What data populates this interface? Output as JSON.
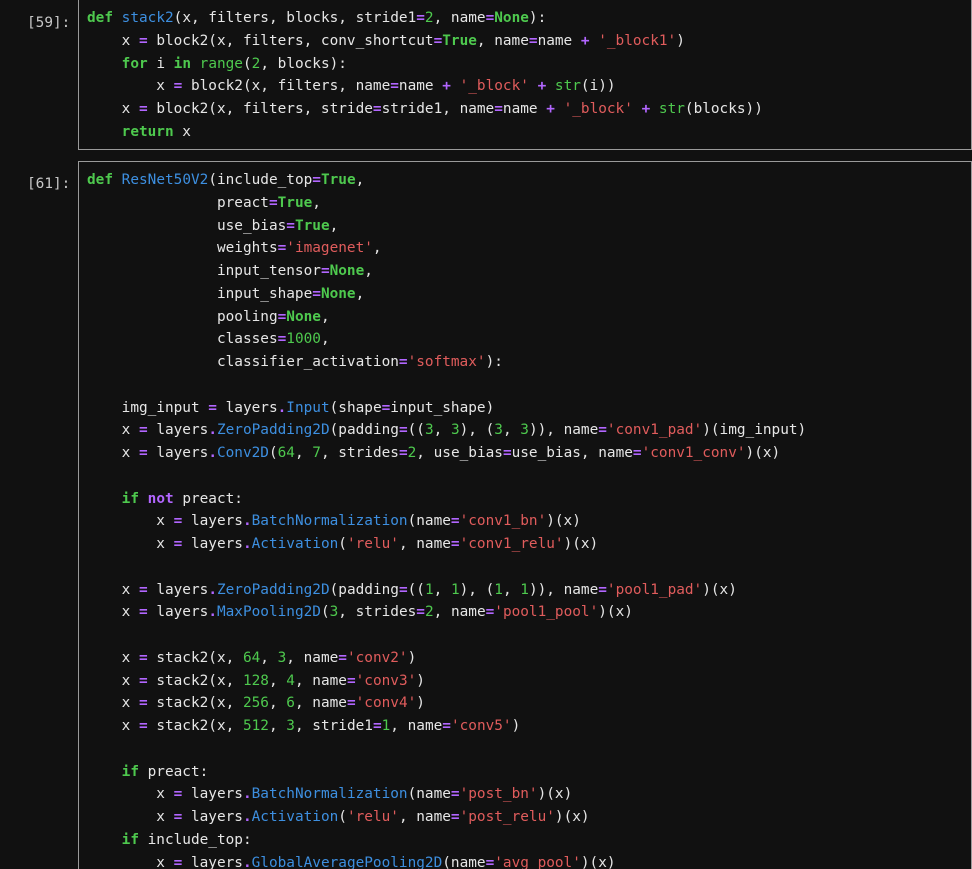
{
  "cells": [
    {
      "prompt": "[59]:",
      "lines": [
        [
          [
            "kw",
            "def"
          ],
          [
            "t",
            " "
          ],
          [
            "fn",
            "stack2"
          ],
          [
            "t",
            "(x, filters, blocks, stride1"
          ],
          [
            "op",
            "="
          ],
          [
            "num",
            "2"
          ],
          [
            "t",
            ", name"
          ],
          [
            "op",
            "="
          ],
          [
            "kw",
            "None"
          ],
          [
            "t",
            "):"
          ]
        ],
        [
          [
            "t",
            "    x "
          ],
          [
            "op",
            "="
          ],
          [
            "t",
            " block2(x, filters, conv_shortcut"
          ],
          [
            "op",
            "="
          ],
          [
            "kw",
            "True"
          ],
          [
            "t",
            ", name"
          ],
          [
            "op",
            "="
          ],
          [
            "t",
            "name "
          ],
          [
            "op",
            "+"
          ],
          [
            "t",
            " "
          ],
          [
            "str",
            "'_block1'"
          ],
          [
            "t",
            ")"
          ]
        ],
        [
          [
            "t",
            "    "
          ],
          [
            "kw",
            "for"
          ],
          [
            "t",
            " i "
          ],
          [
            "kw",
            "in"
          ],
          [
            "t",
            " "
          ],
          [
            "bi",
            "range"
          ],
          [
            "t",
            "("
          ],
          [
            "num",
            "2"
          ],
          [
            "t",
            ", blocks):"
          ]
        ],
        [
          [
            "t",
            "        x "
          ],
          [
            "op",
            "="
          ],
          [
            "t",
            " block2(x, filters, name"
          ],
          [
            "op",
            "="
          ],
          [
            "t",
            "name "
          ],
          [
            "op",
            "+"
          ],
          [
            "t",
            " "
          ],
          [
            "str",
            "'_block'"
          ],
          [
            "t",
            " "
          ],
          [
            "op",
            "+"
          ],
          [
            "t",
            " "
          ],
          [
            "bi",
            "str"
          ],
          [
            "t",
            "(i))"
          ]
        ],
        [
          [
            "t",
            "    x "
          ],
          [
            "op",
            "="
          ],
          [
            "t",
            " block2(x, filters, stride"
          ],
          [
            "op",
            "="
          ],
          [
            "t",
            "stride1, name"
          ],
          [
            "op",
            "="
          ],
          [
            "t",
            "name "
          ],
          [
            "op",
            "+"
          ],
          [
            "t",
            " "
          ],
          [
            "str",
            "'_block'"
          ],
          [
            "t",
            " "
          ],
          [
            "op",
            "+"
          ],
          [
            "t",
            " "
          ],
          [
            "bi",
            "str"
          ],
          [
            "t",
            "(blocks))"
          ]
        ],
        [
          [
            "t",
            "    "
          ],
          [
            "kw",
            "return"
          ],
          [
            "t",
            " x"
          ]
        ]
      ]
    },
    {
      "prompt": "[61]:",
      "lines": [
        [
          [
            "kw",
            "def"
          ],
          [
            "t",
            " "
          ],
          [
            "fn",
            "ResNet50V2"
          ],
          [
            "t",
            "(include_top"
          ],
          [
            "op",
            "="
          ],
          [
            "kw",
            "True"
          ],
          [
            "t",
            ","
          ]
        ],
        [
          [
            "t",
            "               preact"
          ],
          [
            "op",
            "="
          ],
          [
            "kw",
            "True"
          ],
          [
            "t",
            ","
          ]
        ],
        [
          [
            "t",
            "               use_bias"
          ],
          [
            "op",
            "="
          ],
          [
            "kw",
            "True"
          ],
          [
            "t",
            ","
          ]
        ],
        [
          [
            "t",
            "               weights"
          ],
          [
            "op",
            "="
          ],
          [
            "str",
            "'imagenet'"
          ],
          [
            "t",
            ","
          ]
        ],
        [
          [
            "t",
            "               input_tensor"
          ],
          [
            "op",
            "="
          ],
          [
            "kw",
            "None"
          ],
          [
            "t",
            ","
          ]
        ],
        [
          [
            "t",
            "               input_shape"
          ],
          [
            "op",
            "="
          ],
          [
            "kw",
            "None"
          ],
          [
            "t",
            ","
          ]
        ],
        [
          [
            "t",
            "               pooling"
          ],
          [
            "op",
            "="
          ],
          [
            "kw",
            "None"
          ],
          [
            "t",
            ","
          ]
        ],
        [
          [
            "t",
            "               classes"
          ],
          [
            "op",
            "="
          ],
          [
            "num",
            "1000"
          ],
          [
            "t",
            ","
          ]
        ],
        [
          [
            "t",
            "               classifier_activation"
          ],
          [
            "op",
            "="
          ],
          [
            "str",
            "'softmax'"
          ],
          [
            "t",
            "):"
          ]
        ],
        [
          [
            "t",
            ""
          ]
        ],
        [
          [
            "t",
            "    img_input "
          ],
          [
            "op",
            "="
          ],
          [
            "t",
            " layers"
          ],
          [
            "op",
            "."
          ],
          [
            "cls",
            "Input"
          ],
          [
            "t",
            "(shape"
          ],
          [
            "op",
            "="
          ],
          [
            "t",
            "input_shape)"
          ]
        ],
        [
          [
            "t",
            "    x "
          ],
          [
            "op",
            "="
          ],
          [
            "t",
            " layers"
          ],
          [
            "op",
            "."
          ],
          [
            "cls",
            "ZeroPadding2D"
          ],
          [
            "t",
            "(padding"
          ],
          [
            "op",
            "="
          ],
          [
            "t",
            "(("
          ],
          [
            "num",
            "3"
          ],
          [
            "t",
            ", "
          ],
          [
            "num",
            "3"
          ],
          [
            "t",
            "), ("
          ],
          [
            "num",
            "3"
          ],
          [
            "t",
            ", "
          ],
          [
            "num",
            "3"
          ],
          [
            "t",
            ")), name"
          ],
          [
            "op",
            "="
          ],
          [
            "str",
            "'conv1_pad'"
          ],
          [
            "t",
            ")(img_input)"
          ]
        ],
        [
          [
            "t",
            "    x "
          ],
          [
            "op",
            "="
          ],
          [
            "t",
            " layers"
          ],
          [
            "op",
            "."
          ],
          [
            "cls",
            "Conv2D"
          ],
          [
            "t",
            "("
          ],
          [
            "num",
            "64"
          ],
          [
            "t",
            ", "
          ],
          [
            "num",
            "7"
          ],
          [
            "t",
            ", strides"
          ],
          [
            "op",
            "="
          ],
          [
            "num",
            "2"
          ],
          [
            "t",
            ", use_bias"
          ],
          [
            "op",
            "="
          ],
          [
            "t",
            "use_bias, name"
          ],
          [
            "op",
            "="
          ],
          [
            "str",
            "'conv1_conv'"
          ],
          [
            "t",
            ")(x)"
          ]
        ],
        [
          [
            "t",
            ""
          ]
        ],
        [
          [
            "t",
            "    "
          ],
          [
            "kw",
            "if"
          ],
          [
            "t",
            " "
          ],
          [
            "op",
            "not"
          ],
          [
            "t",
            " preact:"
          ]
        ],
        [
          [
            "t",
            "        x "
          ],
          [
            "op",
            "="
          ],
          [
            "t",
            " layers"
          ],
          [
            "op",
            "."
          ],
          [
            "cls",
            "BatchNormalization"
          ],
          [
            "t",
            "(name"
          ],
          [
            "op",
            "="
          ],
          [
            "str",
            "'conv1_bn'"
          ],
          [
            "t",
            ")(x)"
          ]
        ],
        [
          [
            "t",
            "        x "
          ],
          [
            "op",
            "="
          ],
          [
            "t",
            " layers"
          ],
          [
            "op",
            "."
          ],
          [
            "cls",
            "Activation"
          ],
          [
            "t",
            "("
          ],
          [
            "str",
            "'relu'"
          ],
          [
            "t",
            ", name"
          ],
          [
            "op",
            "="
          ],
          [
            "str",
            "'conv1_relu'"
          ],
          [
            "t",
            ")(x)"
          ]
        ],
        [
          [
            "t",
            ""
          ]
        ],
        [
          [
            "t",
            "    x "
          ],
          [
            "op",
            "="
          ],
          [
            "t",
            " layers"
          ],
          [
            "op",
            "."
          ],
          [
            "cls",
            "ZeroPadding2D"
          ],
          [
            "t",
            "(padding"
          ],
          [
            "op",
            "="
          ],
          [
            "t",
            "(("
          ],
          [
            "num",
            "1"
          ],
          [
            "t",
            ", "
          ],
          [
            "num",
            "1"
          ],
          [
            "t",
            "), ("
          ],
          [
            "num",
            "1"
          ],
          [
            "t",
            ", "
          ],
          [
            "num",
            "1"
          ],
          [
            "t",
            ")), name"
          ],
          [
            "op",
            "="
          ],
          [
            "str",
            "'pool1_pad'"
          ],
          [
            "t",
            ")(x)"
          ]
        ],
        [
          [
            "t",
            "    x "
          ],
          [
            "op",
            "="
          ],
          [
            "t",
            " layers"
          ],
          [
            "op",
            "."
          ],
          [
            "cls",
            "MaxPooling2D"
          ],
          [
            "t",
            "("
          ],
          [
            "num",
            "3"
          ],
          [
            "t",
            ", strides"
          ],
          [
            "op",
            "="
          ],
          [
            "num",
            "2"
          ],
          [
            "t",
            ", name"
          ],
          [
            "op",
            "="
          ],
          [
            "str",
            "'pool1_pool'"
          ],
          [
            "t",
            ")(x)"
          ]
        ],
        [
          [
            "t",
            ""
          ]
        ],
        [
          [
            "t",
            "    x "
          ],
          [
            "op",
            "="
          ],
          [
            "t",
            " stack2(x, "
          ],
          [
            "num",
            "64"
          ],
          [
            "t",
            ", "
          ],
          [
            "num",
            "3"
          ],
          [
            "t",
            ", name"
          ],
          [
            "op",
            "="
          ],
          [
            "str",
            "'conv2'"
          ],
          [
            "t",
            ")"
          ]
        ],
        [
          [
            "t",
            "    x "
          ],
          [
            "op",
            "="
          ],
          [
            "t",
            " stack2(x, "
          ],
          [
            "num",
            "128"
          ],
          [
            "t",
            ", "
          ],
          [
            "num",
            "4"
          ],
          [
            "t",
            ", name"
          ],
          [
            "op",
            "="
          ],
          [
            "str",
            "'conv3'"
          ],
          [
            "t",
            ")"
          ]
        ],
        [
          [
            "t",
            "    x "
          ],
          [
            "op",
            "="
          ],
          [
            "t",
            " stack2(x, "
          ],
          [
            "num",
            "256"
          ],
          [
            "t",
            ", "
          ],
          [
            "num",
            "6"
          ],
          [
            "t",
            ", name"
          ],
          [
            "op",
            "="
          ],
          [
            "str",
            "'conv4'"
          ],
          [
            "t",
            ")"
          ]
        ],
        [
          [
            "t",
            "    x "
          ],
          [
            "op",
            "="
          ],
          [
            "t",
            " stack2(x, "
          ],
          [
            "num",
            "512"
          ],
          [
            "t",
            ", "
          ],
          [
            "num",
            "3"
          ],
          [
            "t",
            ", stride1"
          ],
          [
            "op",
            "="
          ],
          [
            "num",
            "1"
          ],
          [
            "t",
            ", name"
          ],
          [
            "op",
            "="
          ],
          [
            "str",
            "'conv5'"
          ],
          [
            "t",
            ")"
          ]
        ],
        [
          [
            "t",
            ""
          ]
        ],
        [
          [
            "t",
            "    "
          ],
          [
            "kw",
            "if"
          ],
          [
            "t",
            " preact:"
          ]
        ],
        [
          [
            "t",
            "        x "
          ],
          [
            "op",
            "="
          ],
          [
            "t",
            " layers"
          ],
          [
            "op",
            "."
          ],
          [
            "cls",
            "BatchNormalization"
          ],
          [
            "t",
            "(name"
          ],
          [
            "op",
            "="
          ],
          [
            "str",
            "'post_bn'"
          ],
          [
            "t",
            ")(x)"
          ]
        ],
        [
          [
            "t",
            "        x "
          ],
          [
            "op",
            "="
          ],
          [
            "t",
            " layers"
          ],
          [
            "op",
            "."
          ],
          [
            "cls",
            "Activation"
          ],
          [
            "t",
            "("
          ],
          [
            "str",
            "'relu'"
          ],
          [
            "t",
            ", name"
          ],
          [
            "op",
            "="
          ],
          [
            "str",
            "'post_relu'"
          ],
          [
            "t",
            ")(x)"
          ]
        ],
        [
          [
            "t",
            "    "
          ],
          [
            "kw",
            "if"
          ],
          [
            "t",
            " include_top:"
          ]
        ],
        [
          [
            "t",
            "        x "
          ],
          [
            "op",
            "="
          ],
          [
            "t",
            " layers"
          ],
          [
            "op",
            "."
          ],
          [
            "cls",
            "GlobalAveragePooling2D"
          ],
          [
            "t",
            "(name"
          ],
          [
            "op",
            "="
          ],
          [
            "str",
            "'avg_pool'"
          ],
          [
            "t",
            ")(x)"
          ]
        ]
      ]
    }
  ]
}
